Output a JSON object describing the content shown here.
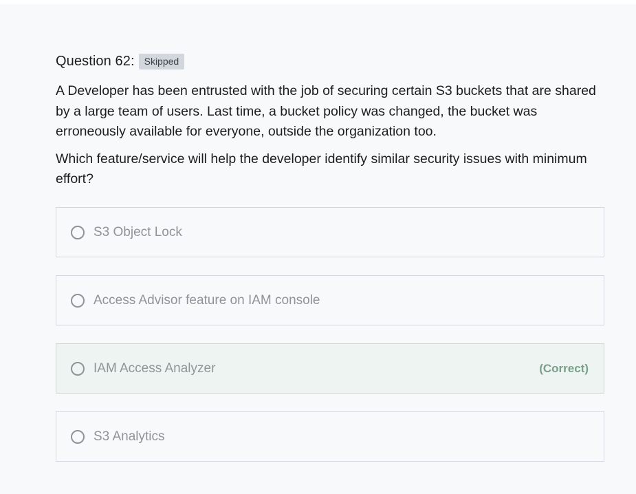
{
  "question": {
    "title": "Question 62:",
    "status_badge": "Skipped",
    "prompt_paragraph_1": "A Developer has been entrusted with the job of securing certain S3 buckets that are shared by a large team of users. Last time, a bucket policy was changed, the bucket was erroneously available for everyone, outside the organization too.",
    "prompt_paragraph_2": "Which feature/service will help the developer identify similar security issues with minimum effort?"
  },
  "options": [
    {
      "label": "S3 Object Lock"
    },
    {
      "label": "Access Advisor feature on IAM console"
    },
    {
      "label": "IAM Access Analyzer",
      "tag": "(Correct)"
    },
    {
      "label": "S3 Analytics"
    }
  ]
}
